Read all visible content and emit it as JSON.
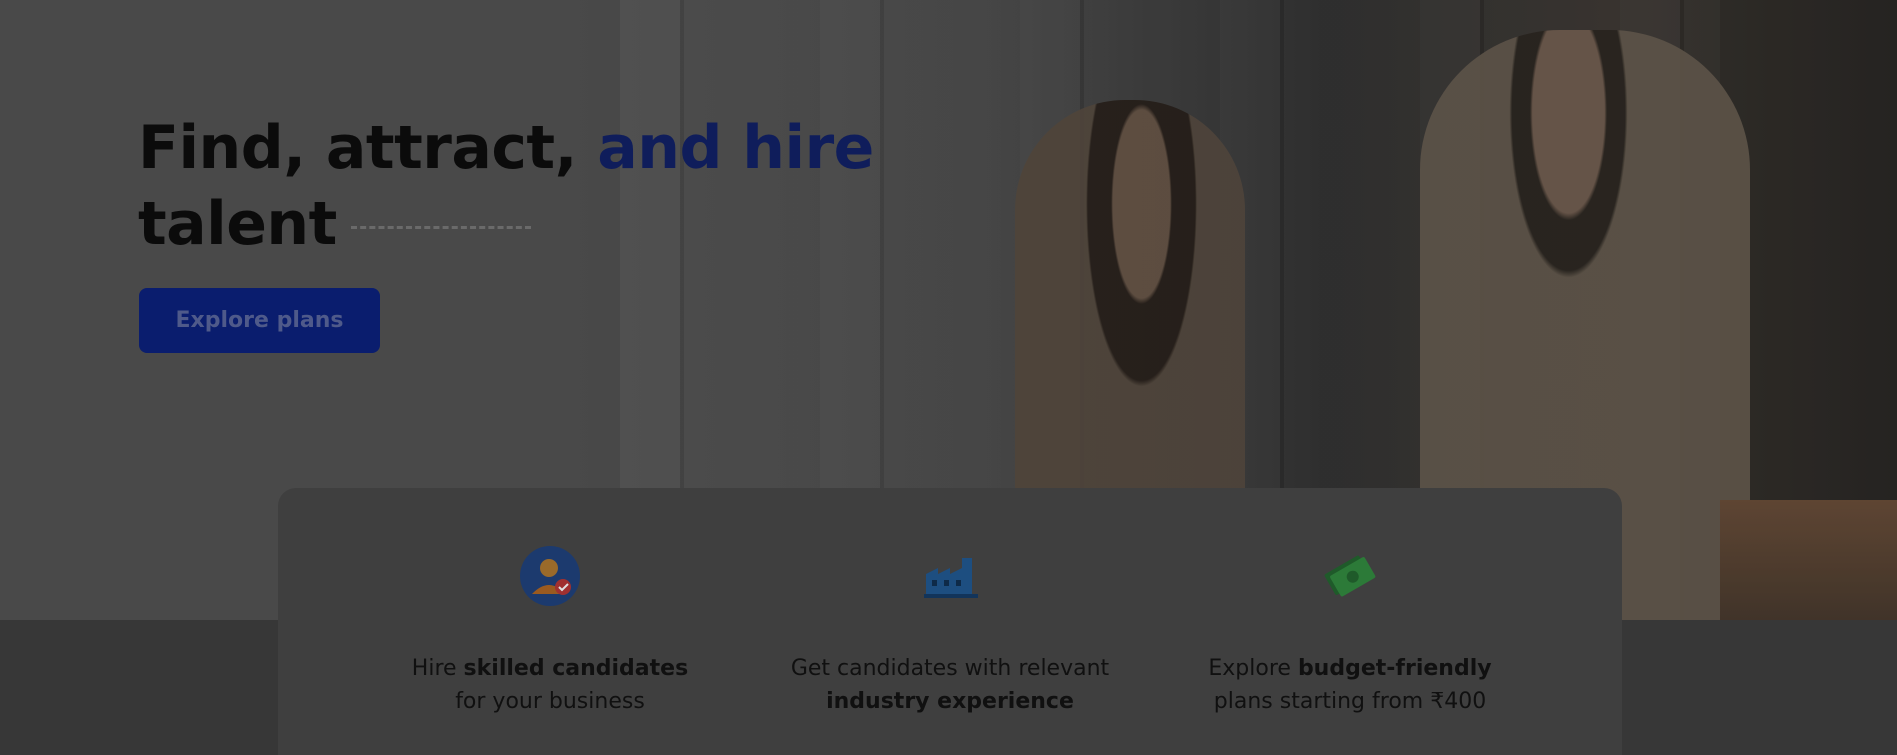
{
  "hero": {
    "headline_line1_part1": "Find, attract, ",
    "headline_line1_part2": "and hire",
    "headline_line2": "talent",
    "cta_label": "Explore plans"
  },
  "features": [
    {
      "icon": "candidate-check-icon",
      "line1_pre": "Hire ",
      "line1_bold": "skilled candidates",
      "line2_pre": "for your business",
      "line2_bold": ""
    },
    {
      "icon": "industry-factory-icon",
      "line1_pre": "Get candidates with relevant",
      "line1_bold": "",
      "line2_pre": "",
      "line2_bold": "industry experience"
    },
    {
      "icon": "money-cash-icon",
      "line1_pre": "Explore ",
      "line1_bold": "budget-friendly",
      "line2_pre": "plans starting from ₹400",
      "line2_bold": ""
    }
  ],
  "colors": {
    "accent": "#0f1d5b",
    "cta_bg": "#0a1d6e",
    "overlay_bg": "#3f3f3f"
  }
}
